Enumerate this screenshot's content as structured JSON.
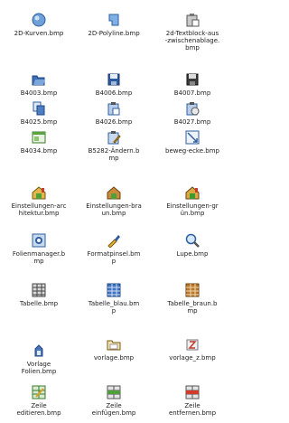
{
  "files": [
    {
      "label": "2D-Kurven.bmp",
      "icon": "curve-icon"
    },
    {
      "label": "2D-Polyline.bmp",
      "icon": "polyline-icon"
    },
    {
      "label": "2d-Textblock-aus\n-zwischenablage.\nbmp",
      "icon": "clipboard-text-icon"
    },
    {
      "label": "B4003.bmp",
      "icon": "open-folder-icon"
    },
    {
      "label": "B4006.bmp",
      "icon": "save-disk-icon"
    },
    {
      "label": "B4007.bmp",
      "icon": "save-as-icon"
    },
    {
      "label": "B4025.bmp",
      "icon": "copy-icon"
    },
    {
      "label": "B4026.bmp",
      "icon": "paste-icon"
    },
    {
      "label": "B4027.bmp",
      "icon": "paste-special-icon"
    },
    {
      "label": "B4034.bmp",
      "icon": "new-window-icon"
    },
    {
      "label": "B5282-Ändern.b\nmp",
      "icon": "edit-icon"
    },
    {
      "label": "beweg-ecke.bmp",
      "icon": "move-corner-icon"
    },
    {
      "label": "Einstellungen-arc\nhitektur.bmp",
      "icon": "settings-architecture-icon"
    },
    {
      "label": "Einstellungen-bra\nun.bmp",
      "icon": "settings-brown-icon"
    },
    {
      "label": "Einstellungen-gr\nün.bmp",
      "icon": "settings-green-icon"
    },
    {
      "label": "Folienmanager.b\nmp",
      "icon": "layer-manager-icon"
    },
    {
      "label": "Formatpinsel.bm\np",
      "icon": "format-painter-icon"
    },
    {
      "label": "Lupe.bmp",
      "icon": "magnifier-icon"
    },
    {
      "label": "Tabelle.bmp",
      "icon": "table-icon"
    },
    {
      "label": "Tabelle_blau.bm\np",
      "icon": "table-blue-icon"
    },
    {
      "label": "Tabelle_braun.b\nmp",
      "icon": "table-brown-icon"
    },
    {
      "label": "Vorlage\nFolien.bmp",
      "icon": "template-layers-icon"
    },
    {
      "label": "vorlage.bmp",
      "icon": "template-folder-icon"
    },
    {
      "label": "vorlage_z.bmp",
      "icon": "template-z-icon"
    },
    {
      "label": "Zeile\neditieren.bmp",
      "icon": "row-edit-icon"
    },
    {
      "label": "Zeile\neinfügen.bmp",
      "icon": "row-insert-icon"
    },
    {
      "label": "Zeile\nentfernen.bmp",
      "icon": "row-delete-icon"
    }
  ]
}
